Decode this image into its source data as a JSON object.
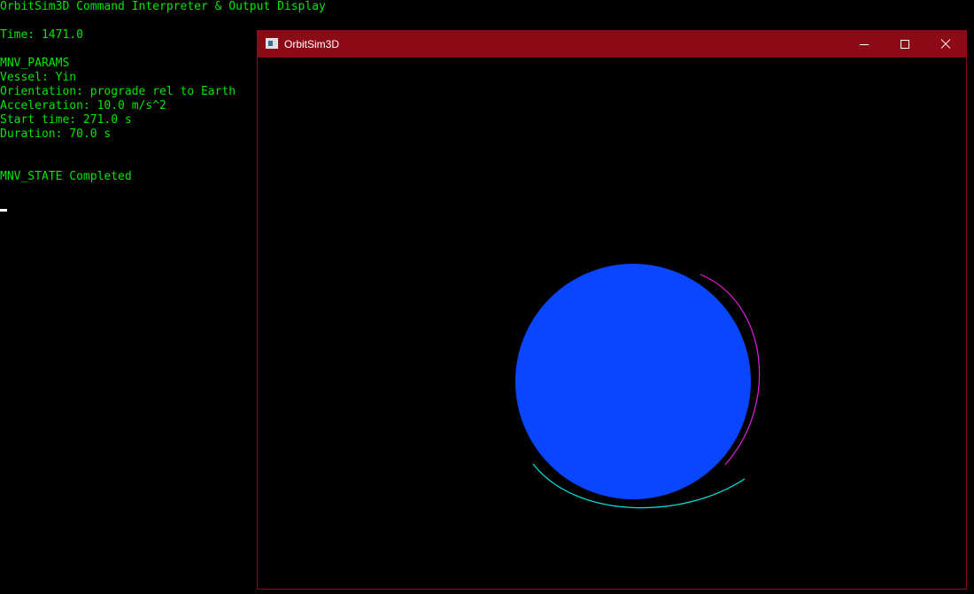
{
  "console": {
    "title": "OrbitSim3D Command Interpreter & Output Display",
    "time": "Time: 1471.0",
    "mnv_params_header": "MNV_PARAMS",
    "vessel": "Vessel: Yin",
    "orientation": "Orientation: prograde rel to Earth",
    "acceleration": "Acceleration: 10.0 m/s^2",
    "start_time": "Start time: 271.0 s",
    "duration": "Duration: 70.0 s",
    "mnv_state": "MNV_STATE Completed",
    "text_color": "#00e600"
  },
  "window": {
    "title": "OrbitSim3D",
    "titlebar_color": "#8b0a16",
    "controls": {
      "minimize": "minimize-icon",
      "maximize": "maximize-icon",
      "close": "close-icon"
    }
  },
  "scene": {
    "earth_color": "#0a46ff",
    "orbit_trail_1_color": "#e020e0",
    "orbit_trail_2_color": "#00e5e5"
  }
}
